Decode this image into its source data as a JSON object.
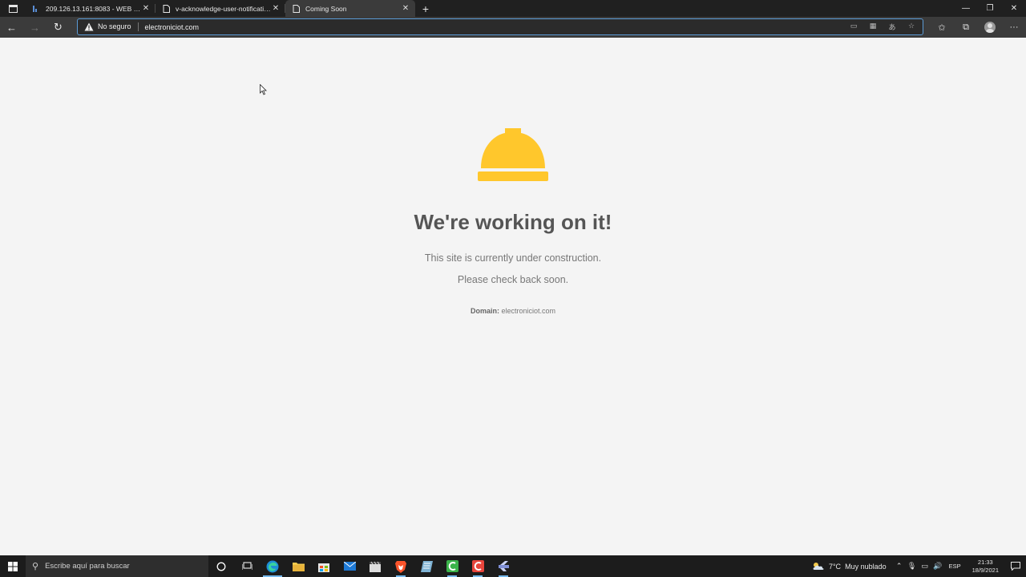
{
  "browser": {
    "tabs": [
      {
        "title": "209.126.13.161:8083 - WEB - Pan",
        "active": false,
        "favicon": "chart-favicon-icon"
      },
      {
        "title": "v-acknowledge-user-notification",
        "active": false,
        "favicon": "page-icon"
      },
      {
        "title": "Coming Soon",
        "active": true,
        "favicon": "page-icon"
      }
    ],
    "new_tab_label": "+",
    "address": {
      "security_label": "No seguro",
      "url": "electroniciot.com"
    }
  },
  "page": {
    "heading": "We're working on it!",
    "line1": "This site is currently under construction.",
    "line2": "Please check back soon.",
    "domain_label": "Domain:",
    "domain_value": "electroniciot.com",
    "accent_color": "#ffc72c"
  },
  "taskbar": {
    "search_placeholder": "Escribe aquí para buscar",
    "weather_temp": "7°C",
    "weather_desc": "Muy nublado",
    "language": "ESP",
    "time": "21:33",
    "date": "18/9/2021"
  }
}
